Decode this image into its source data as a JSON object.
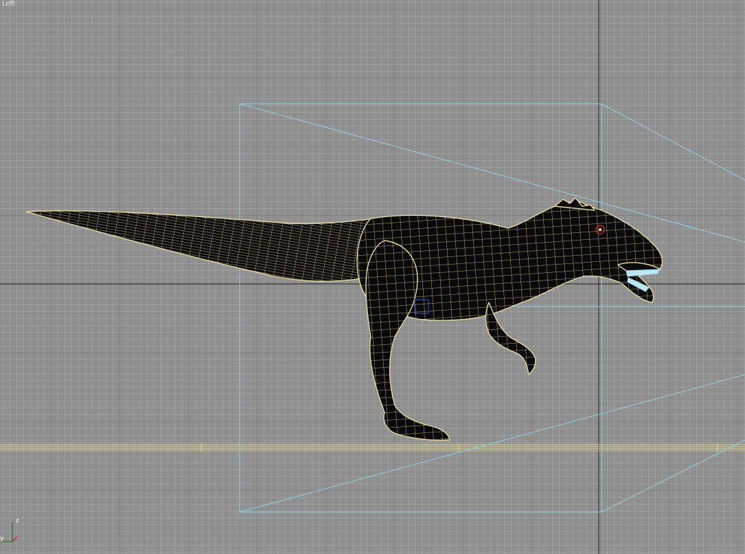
{
  "viewport": {
    "label": "Left",
    "background": "#8f8f8f"
  },
  "axis_gizmo": {
    "z_label": "z",
    "y_label": "y",
    "x_label": "x"
  },
  "colors": {
    "wireframe": "#e8d9a0",
    "mesh_fill": "#0a0a0a",
    "camera_frustum": "#8fd3e6",
    "teeth": "#9fd8ea",
    "eye": "#c8201c",
    "ground_lines": "#e6dc8c",
    "origin_axes": "#202020"
  },
  "model": {
    "name": "dinosaur-mesh"
  }
}
